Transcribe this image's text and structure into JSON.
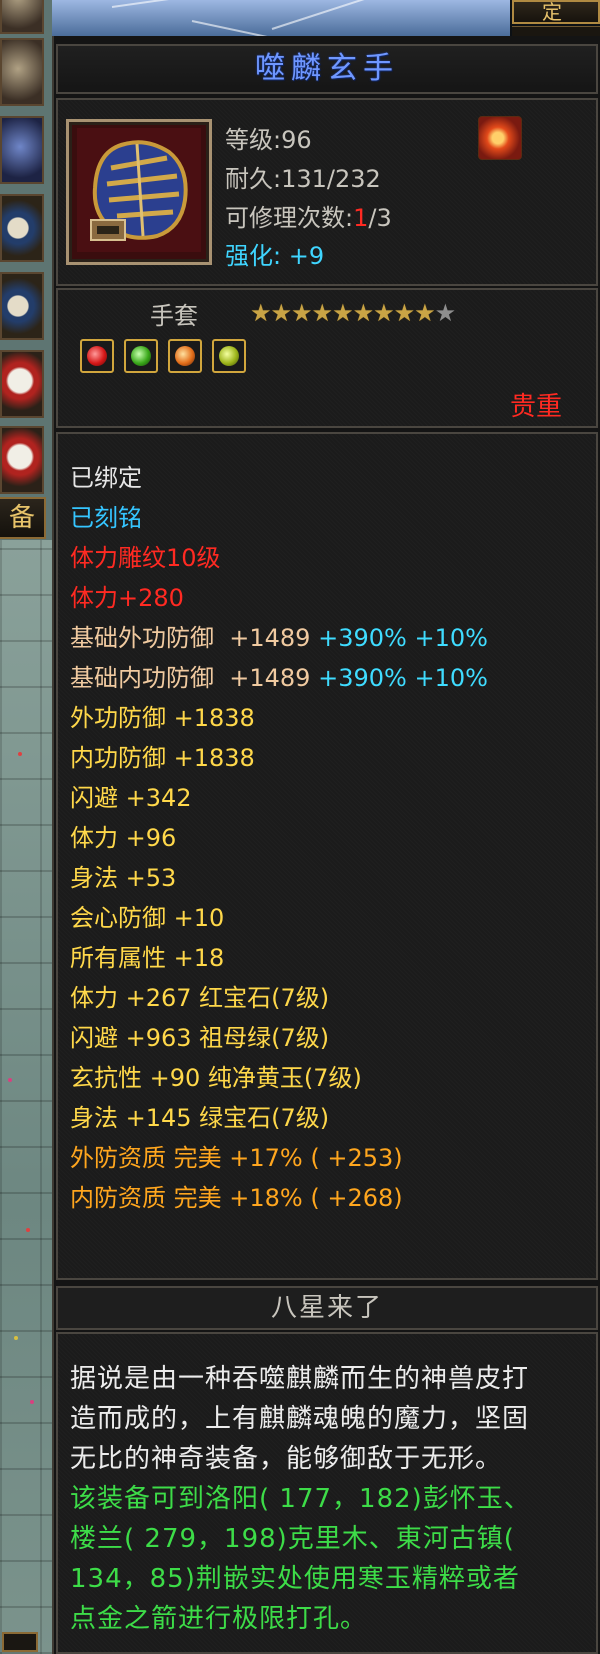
{
  "top": {
    "button_label": "定",
    "button_sub": ""
  },
  "left": {
    "equip_tab_label": "备"
  },
  "item": {
    "name": "噬麟玄手",
    "level_label": "等级:",
    "level": "96",
    "durability_label": "耐久:",
    "durability": "131/232",
    "repair_label": "可修理次数:",
    "repair_used": "1",
    "repair_total": "/3",
    "strength_label": "强化:",
    "strength": "+9",
    "type": "手套",
    "stars_total": 10,
    "stars_lit": 9,
    "quality": "贵重",
    "gem_sockets": [
      "red-gem-icon",
      "green-gem-icon",
      "orange-gem-icon",
      "yellow-gem-icon"
    ]
  },
  "stats": {
    "bound": "已绑定",
    "engraved": "已刻铭",
    "carving": "体力雕纹10级",
    "carving_bonus": "体力+280",
    "base_ext_def": {
      "label": "基础外功防御",
      "value": "+1489",
      "pct": "+390%",
      "pct2": "+10%"
    },
    "base_int_def": {
      "label": "基础内功防御",
      "value": "+1489",
      "pct": "+390%",
      "pct2": "+10%"
    },
    "lines": [
      "外功防御 +1838",
      "内功防御 +1838",
      "闪避 +342",
      "体力 +96",
      "身法 +53",
      "会心防御 +10",
      "所有属性 +18",
      "体力 +267 红宝石(7级)",
      "闪避 +963 祖母绿(7级)",
      "玄抗性 +90 纯净黄玉(7级)",
      "身法 +145 绿宝石(7级)"
    ],
    "quality_lines": [
      "外防资质  完美 +17% ( +253)",
      "内防资质  完美 +18% ( +268)"
    ]
  },
  "section_title": "八星来了",
  "description": {
    "white": [
      "据说是由一种吞噬麒麟而生的神兽皮打",
      "造而成的，上有麒麟魂魄的魔力，坚固",
      "无比的神奇装备，能够御敌于无形。"
    ],
    "green": [
      "该装备可到洛阳( 177，182)彭怀玉、",
      "楼兰( 279，198)克里木、東河古镇(",
      "134，85)荆嵌实处使用寒玉精粹或者",
      "点金之箭进行极限打孔。"
    ]
  }
}
